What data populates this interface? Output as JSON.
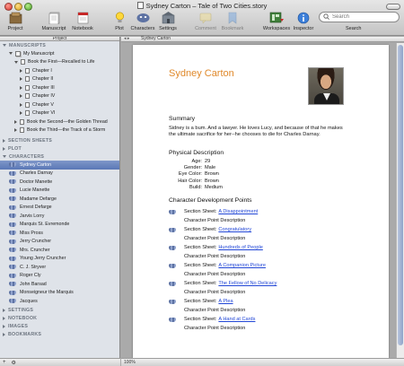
{
  "window": {
    "title": "Sydney Carton – Tale of Two Cities.story"
  },
  "toolbar": {
    "items": [
      {
        "label": "Project",
        "icon": "project-icon"
      },
      {
        "label": "Manuscript",
        "icon": "manuscript-icon"
      },
      {
        "label": "Notebook",
        "icon": "notebook-icon"
      },
      {
        "label": "Plot",
        "icon": "lightbulb-icon"
      },
      {
        "label": "Characters",
        "icon": "characters-icon"
      },
      {
        "label": "Settings",
        "icon": "settings-icon"
      },
      {
        "label": "Comment",
        "icon": "comment-icon"
      },
      {
        "label": "Bookmark",
        "icon": "bookmark-icon"
      },
      {
        "label": "Workspaces",
        "icon": "workspaces-icon"
      },
      {
        "label": "Inspector",
        "icon": "info-icon"
      }
    ],
    "search": {
      "placeholder": "Search",
      "label": "Search"
    }
  },
  "sidebar": {
    "header": "Project",
    "sections": {
      "manuscripts": "MANUSCRIPTS",
      "section_sheets": "SECTION SHEETS",
      "plot": "PLOT",
      "characters": "CHARACTERS",
      "settings": "SETTINGS",
      "notebook": "NOTEBOOK",
      "images": "IMAGES",
      "bookmarks": "BOOKMARKS"
    },
    "manuscript_tree": [
      {
        "label": "My Manuscript"
      },
      {
        "label": "Book the First—Recalled to Life"
      },
      {
        "label": "Chapter I"
      },
      {
        "label": "Chapter II"
      },
      {
        "label": "Chapter III"
      },
      {
        "label": "Chapter IV"
      },
      {
        "label": "Chapter V"
      },
      {
        "label": "Chapter VI"
      },
      {
        "label": "Book the Second—the Golden Thread"
      },
      {
        "label": "Book the Third—the Track of a Storm"
      }
    ],
    "characters": [
      "Sydney Carton",
      "Charles Darnay",
      "Doctor Manette",
      "Lucie Manette",
      "Madame Defarge",
      "Ernest Defarge",
      "Jarvis Lorry",
      "Marquis St. Evremonde",
      "Miss Pross",
      "Jerry Cruncher",
      "Mrs. Cruncher",
      "Young Jerry Cruncher",
      "C. J. Stryver",
      "Roger Cly",
      "John Barsad",
      "Monseigneur the Marquis",
      "Jacques"
    ],
    "selected_character": "Sydney Carton",
    "footer": {
      "add": "+",
      "gear": "⚙"
    }
  },
  "editor": {
    "header_title": "Sydney Carton",
    "zoom": "100%",
    "character_name": "Sydney Carton",
    "summary_heading": "Summary",
    "summary_text": "Sidney is a bum. And a lawyer. He loves Lucy, and because of that he makes the ultimate sacrifice for her--he chooses to die for Charles Darnay.",
    "physical_heading": "Physical Description",
    "physical": [
      {
        "label": "Age:",
        "value": "29"
      },
      {
        "label": "Gender:",
        "value": "Male"
      },
      {
        "label": "Eye Color:",
        "value": "Brown"
      },
      {
        "label": "Hair Color:",
        "value": "Brown"
      },
      {
        "label": "Build:",
        "value": "Medium"
      }
    ],
    "points_heading": "Character Development Points",
    "points": [
      {
        "sheet_label": "Section Sheet:",
        "link": "A Disappointment",
        "desc": "Character Point Description"
      },
      {
        "sheet_label": "Section Sheet:",
        "link": "Congratulatory",
        "desc": "Character Point Description"
      },
      {
        "sheet_label": "Section Sheet:",
        "link": "Hundreds of People",
        "desc": "Character Point Description"
      },
      {
        "sheet_label": "Section Sheet:",
        "link": "A Companion Picture",
        "desc": "Character Point Description"
      },
      {
        "sheet_label": "Section Sheet:",
        "link": "The Fellow of No Delicacy",
        "desc": "Character Point Description"
      },
      {
        "sheet_label": "Section Sheet:",
        "link": "A Plea",
        "desc": "Character Point Description"
      },
      {
        "sheet_label": "Section Sheet:",
        "link": "A Hand at Cards",
        "desc": "Character Point Description"
      }
    ]
  },
  "colors": {
    "accent_name": "#e0892b",
    "selection": "#5a77b6",
    "link": "#2146d6"
  }
}
